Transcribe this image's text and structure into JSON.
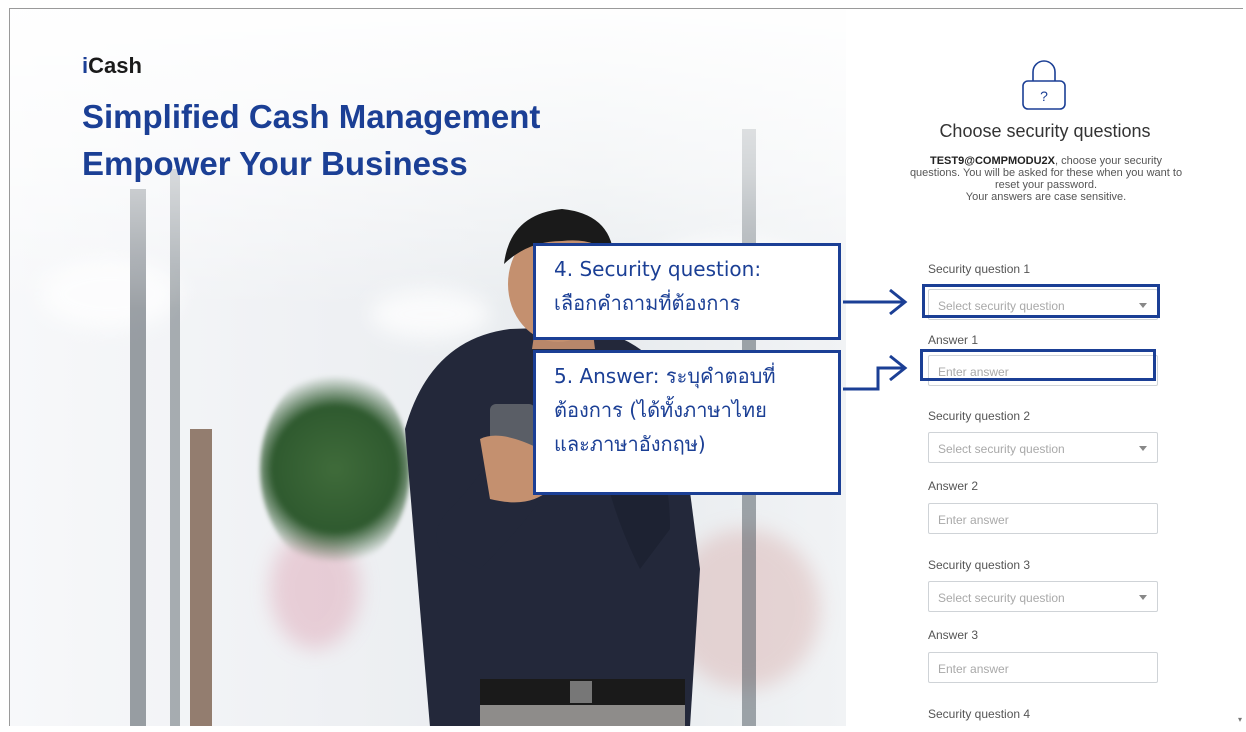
{
  "hero": {
    "brand_i": "i",
    "brand_rest": "Cash",
    "headline_line1": "Simplified Cash Management",
    "headline_line2": "Empower Your Business"
  },
  "form": {
    "icon": "lock-question-icon",
    "title": "Choose security questions",
    "user": "TEST9@COMPMODU2X",
    "desc_rest": ", choose your security questions. You will be asked for these when you want to reset your password.",
    "desc_case": "Your answers are case sensitive.",
    "q1_label": "Security question 1",
    "q1_placeholder": "Select security question",
    "a1_label": "Answer 1",
    "a1_placeholder": "Enter answer",
    "q2_label": "Security question 2",
    "q2_placeholder": "Select security question",
    "a2_label": "Answer 2",
    "a2_placeholder": "Enter answer",
    "q3_label": "Security question 3",
    "q3_placeholder": "Select security question",
    "a3_label": "Answer 3",
    "a3_placeholder": "Enter answer",
    "q4_label": "Security question 4"
  },
  "annotations": {
    "c4_line1": "4. Security question:",
    "c4_line2": "เลือกคำถามที่ต้องการ",
    "c5_line1": "5. Answer: ระบุคำตอบที่",
    "c5_line2": "ต้องการ (ได้ทั้งภาษาไทย",
    "c5_line3": "และภาษาอังกฤษ)",
    "accent": "#1b3f95"
  }
}
